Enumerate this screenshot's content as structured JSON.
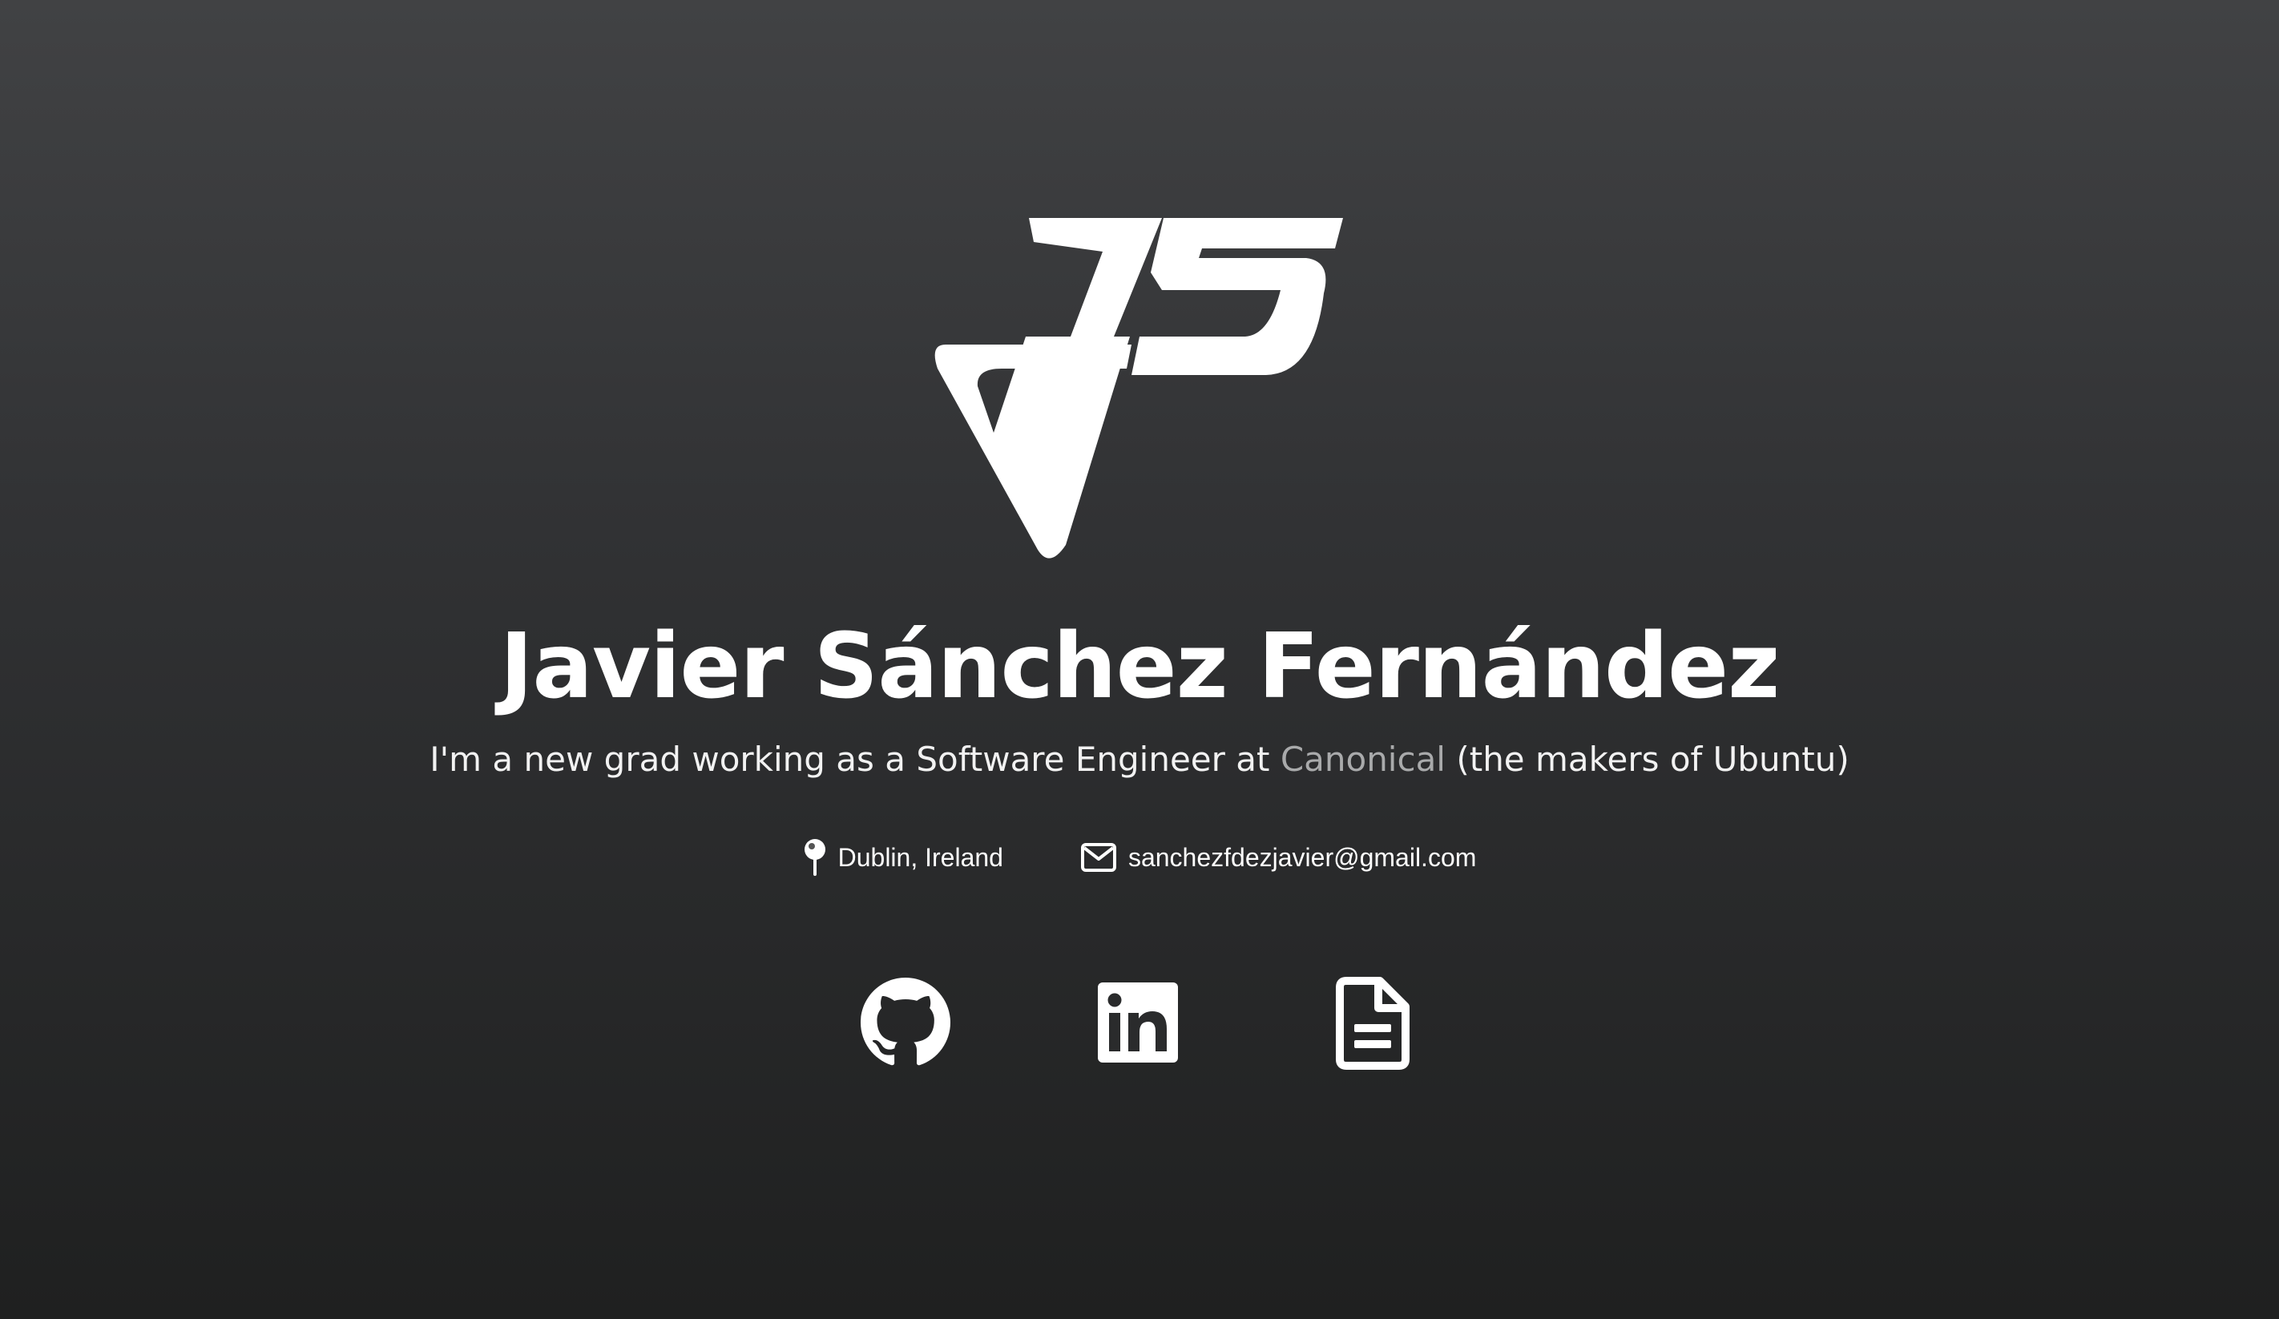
{
  "profile": {
    "name": "Javier Sánchez Fernández",
    "tagline_prefix": "I'm a new grad working as a Software Engineer at ",
    "tagline_link": "Canonical",
    "tagline_suffix": " (the makers of Ubuntu)",
    "location": "Dublin, Ireland",
    "email": "sanchezfdezjavier@gmail.com"
  },
  "logo": {
    "icon": "js-monogram-logo",
    "letters": "JS"
  },
  "socials": [
    {
      "icon": "github-icon"
    },
    {
      "icon": "linkedin-icon"
    },
    {
      "icon": "document-icon"
    }
  ],
  "colors": {
    "background_top": "#414244",
    "background_bottom": "#1f2020",
    "text": "#ffffff",
    "link": "#a9aaab"
  }
}
